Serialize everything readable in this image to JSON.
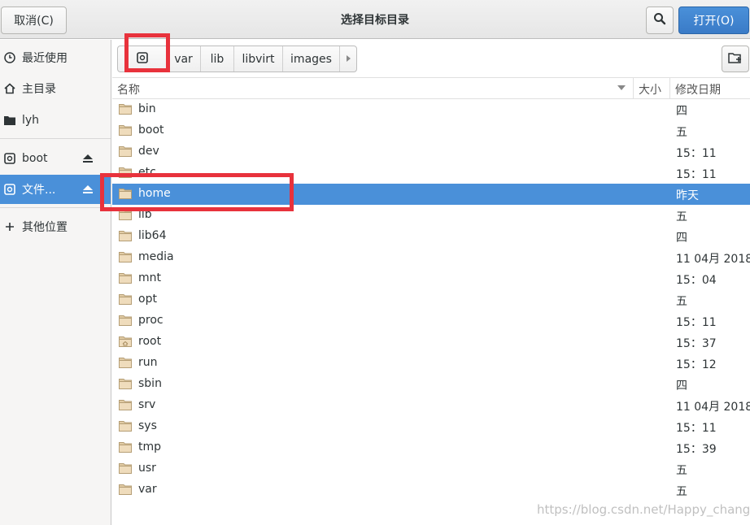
{
  "header": {
    "cancel_label": "取消(C)",
    "title": "选择目标目录",
    "open_label": "打开(O)",
    "search_icon": "search-icon"
  },
  "sidebar": {
    "items": [
      {
        "label": "最近使用",
        "icon": "clock-icon"
      },
      {
        "label": "主目录",
        "icon": "home-icon"
      },
      {
        "label": "lyh",
        "icon": "folder-icon"
      },
      {
        "label": "boot",
        "icon": "drive-icon",
        "eject": true
      },
      {
        "label": "文件...",
        "icon": "drive-icon",
        "eject": true,
        "selected": true
      },
      {
        "label": "其他位置",
        "icon": "plus-icon"
      }
    ]
  },
  "pathbar": {
    "crumbs": [
      "var",
      "lib",
      "libvirt",
      "images"
    ]
  },
  "list": {
    "columns": {
      "name": "名称",
      "size": "大小",
      "modified": "修改日期"
    },
    "rows": [
      {
        "name": "bin",
        "modified": "四"
      },
      {
        "name": "boot",
        "modified": "五"
      },
      {
        "name": "dev",
        "modified": "15：11"
      },
      {
        "name": "etc",
        "modified": "15：11"
      },
      {
        "name": "home",
        "modified": "昨天",
        "selected": true
      },
      {
        "name": "lib",
        "modified": "五"
      },
      {
        "name": "lib64",
        "modified": "四"
      },
      {
        "name": "media",
        "modified": "11 04月 2018"
      },
      {
        "name": "mnt",
        "modified": "15：04"
      },
      {
        "name": "opt",
        "modified": "五"
      },
      {
        "name": "proc",
        "modified": "15：11"
      },
      {
        "name": "root",
        "modified": "15：37"
      },
      {
        "name": "run",
        "modified": "15：12"
      },
      {
        "name": "sbin",
        "modified": "四"
      },
      {
        "name": "srv",
        "modified": "11 04月 2018"
      },
      {
        "name": "sys",
        "modified": "15：11"
      },
      {
        "name": "tmp",
        "modified": "15：39"
      },
      {
        "name": "usr",
        "modified": "五"
      },
      {
        "name": "var",
        "modified": "五"
      }
    ]
  },
  "watermark": "https://blog.csdn.net/Happy_change",
  "colors": {
    "accent": "#4a90d9",
    "highlight_box": "#e8323c"
  }
}
